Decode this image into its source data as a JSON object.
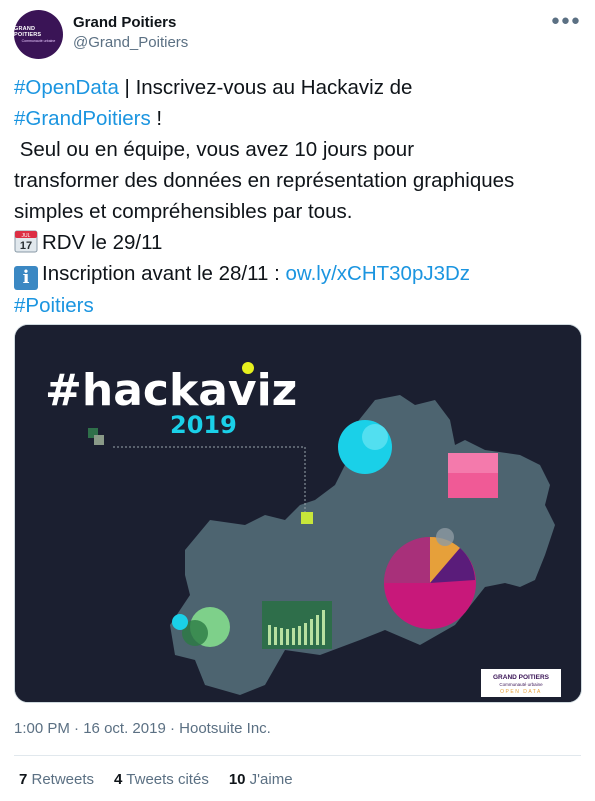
{
  "author": {
    "name": "Grand Poitiers",
    "handle": "@Grand_Poitiers",
    "avatar_line1": "GRAND POITIERS",
    "avatar_line2": "Communauté urbaine"
  },
  "more_icon": "more-horizontal-icon",
  "tweet": {
    "l1_hashtag": "#OpenData",
    "l1_text": " | Inscrivez-vous au Hackaviz de",
    "l2_hashtag": "#GrandPoitiers",
    "l2_text": " !",
    "l3": " Seul ou en équipe, vous avez 10 jours pour",
    "l4": "transformer des données en représentation graphiques",
    "l5": "simples et compréhensibles par tous.",
    "l6_text": "RDV le 29/11",
    "l6_calendar_month": "JUL",
    "l6_calendar_day": "17",
    "l7_info_glyph": "i",
    "l7_text": "Inscription avant le 28/11 : ",
    "l7_link": "ow.ly/xCHT30pJ3Dz",
    "l8_hashtag": "#Poitiers"
  },
  "media": {
    "title": "#hackaviz",
    "year": "2019",
    "logo_line1": "GRAND POITIERS",
    "logo_line2": "Communauté urbaine",
    "logo_line3": "OPEN DATA",
    "colors": {
      "background": "#1b1f30",
      "map": "#4d6470",
      "accent_yellow": "#e6f01e",
      "accent_cyan": "#1ad0e8",
      "accent_pink": "#f05a96",
      "accent_magenta": "#c8187a",
      "accent_green": "#4cae5e"
    }
  },
  "meta": {
    "time": "1:00 PM",
    "separator1": " · ",
    "date": "16 oct. 2019",
    "separator2": " · ",
    "source": "Hootsuite Inc."
  },
  "stats": {
    "retweets_count": "7",
    "retweets_label": " Retweets",
    "quotes_count": "4",
    "quotes_label": " Tweets cités",
    "likes_count": "10",
    "likes_label": " J'aime"
  }
}
